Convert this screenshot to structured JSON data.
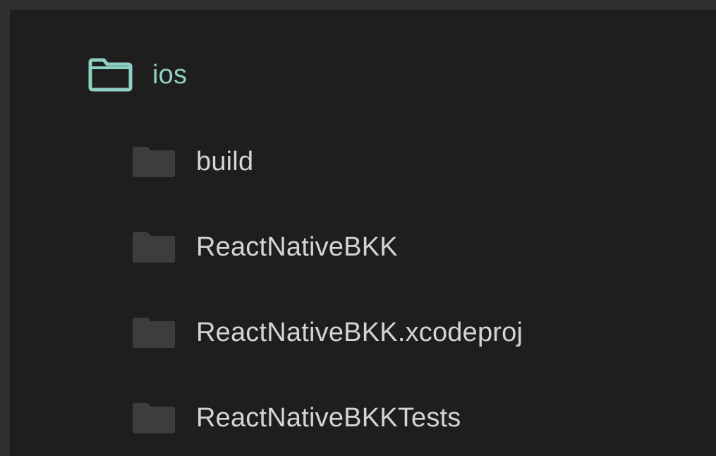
{
  "tree": {
    "root": {
      "label": "ios",
      "icon": "folder-outline-icon",
      "color": "#8fd0c5",
      "expanded": true
    },
    "children": [
      {
        "label": "build",
        "icon": "folder-icon"
      },
      {
        "label": "ReactNativeBKK",
        "icon": "folder-icon"
      },
      {
        "label": "ReactNativeBKK.xcodeproj",
        "icon": "folder-icon"
      },
      {
        "label": "ReactNativeBKKTests",
        "icon": "folder-icon"
      }
    ]
  },
  "colors": {
    "background": "#1e1e1e",
    "border": "#2f2f2f",
    "folder_fill": "#3d3d3d",
    "text": "#d4d4d4"
  }
}
